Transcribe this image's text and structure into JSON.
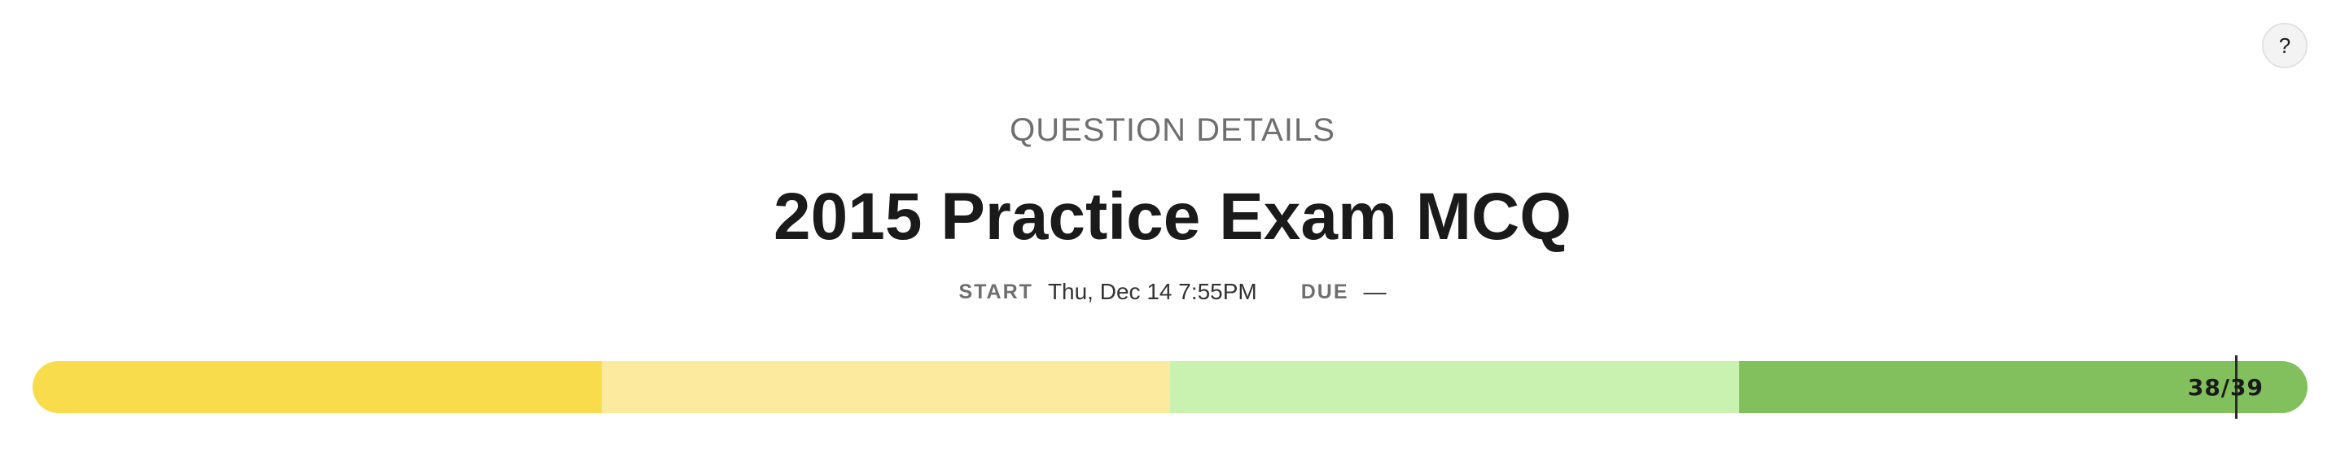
{
  "help": {
    "icon": "help-icon",
    "label": "?"
  },
  "header": {
    "eyebrow": "QUESTION DETAILS",
    "title": "2015 Practice Exam MCQ"
  },
  "meta": {
    "start_label": "START",
    "start_value": "Thu, Dec 14 7:55PM",
    "due_label": "DUE",
    "due_value": "—"
  },
  "progress": {
    "label": "38/39",
    "completed": 38,
    "total": 39,
    "segments": [
      {
        "color": "#f9dc4b"
      },
      {
        "color": "#fcea9f"
      },
      {
        "color": "#c9f2b0"
      },
      {
        "color": "#82bf5d"
      }
    ]
  }
}
